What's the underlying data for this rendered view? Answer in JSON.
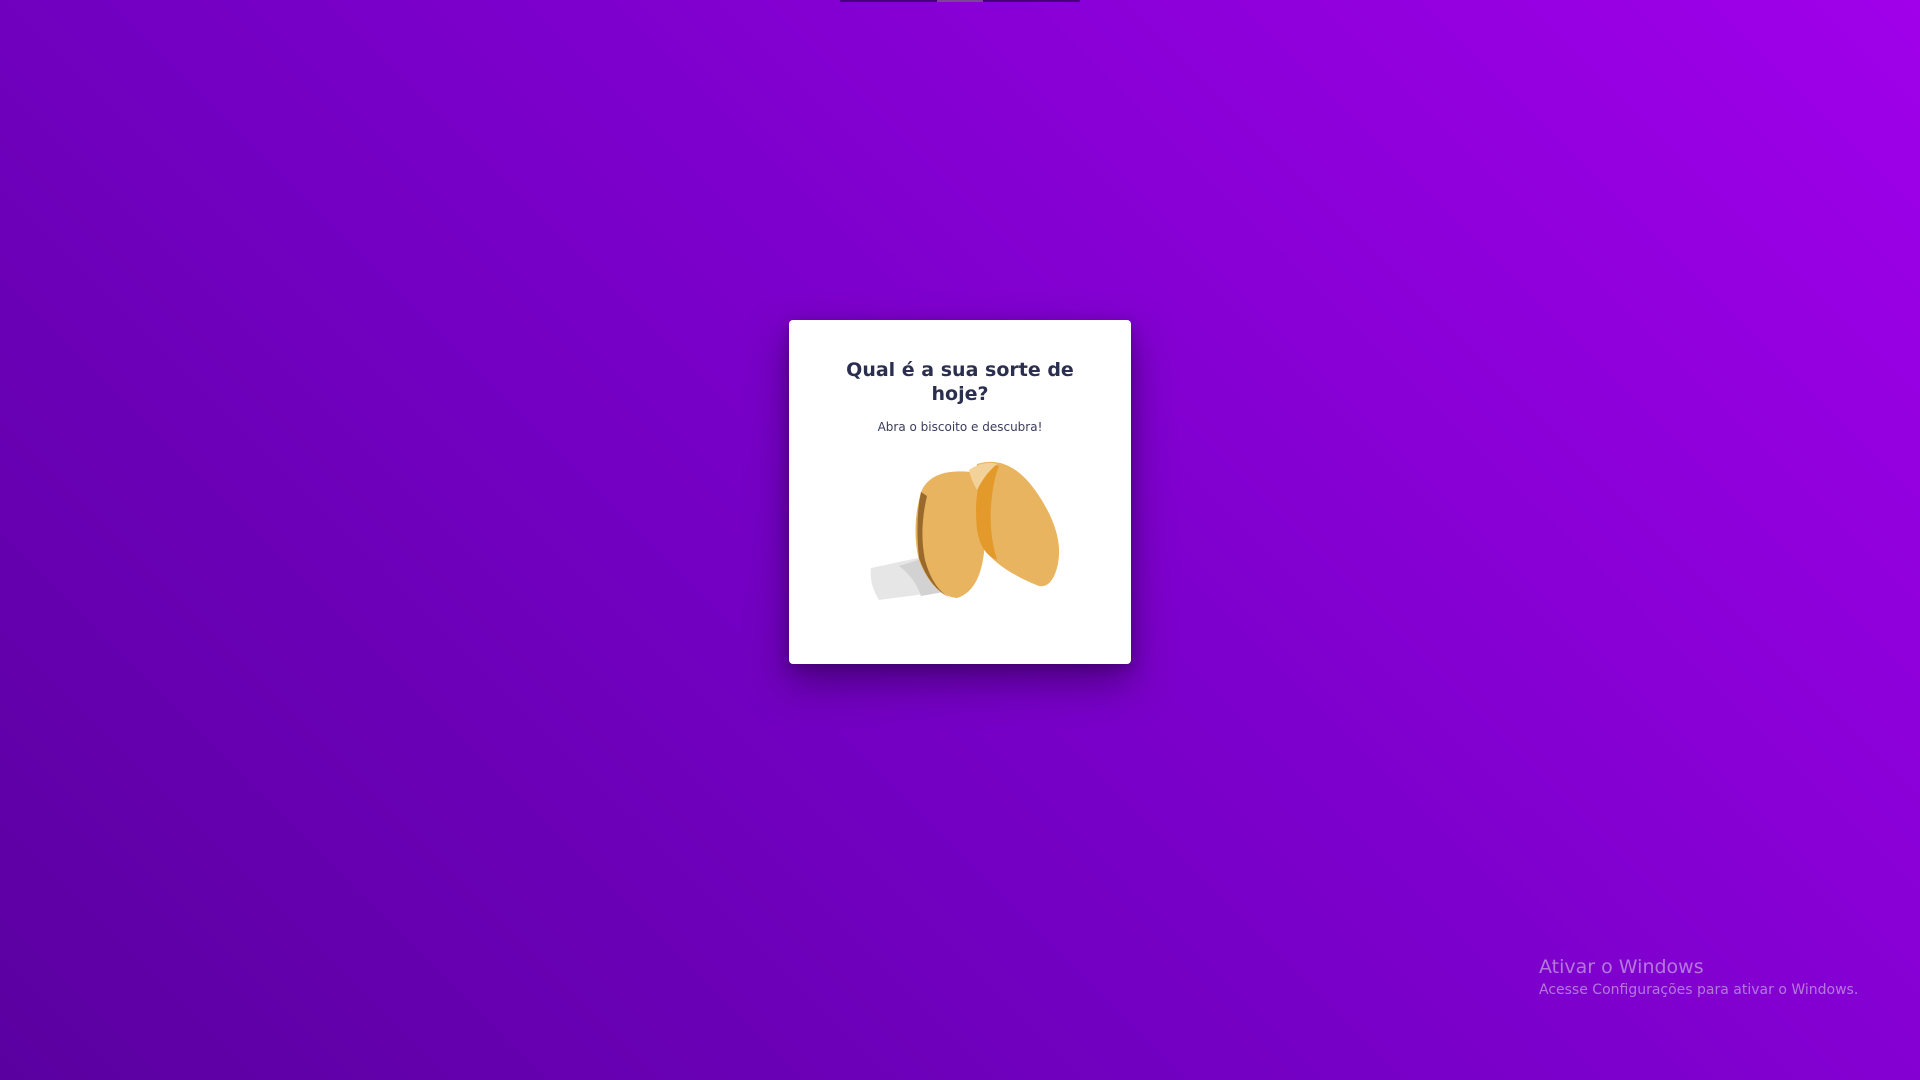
{
  "card": {
    "title": "Qual é a sua sorte de hoje?",
    "subtitle": "Abra o biscoito e descubra!",
    "illustration": "fortune-cookie-icon"
  },
  "watermark": {
    "title": "Ativar o Windows",
    "subtitle": "Acesse Configurações para ativar o Windows."
  },
  "colors": {
    "background_start": "#5a00a0",
    "background_end": "#a000ea",
    "card": "#ffffff",
    "title_text": "#2b2f4f",
    "cookie": "#e9b45f",
    "cookie_dark": "#e39a2a"
  }
}
